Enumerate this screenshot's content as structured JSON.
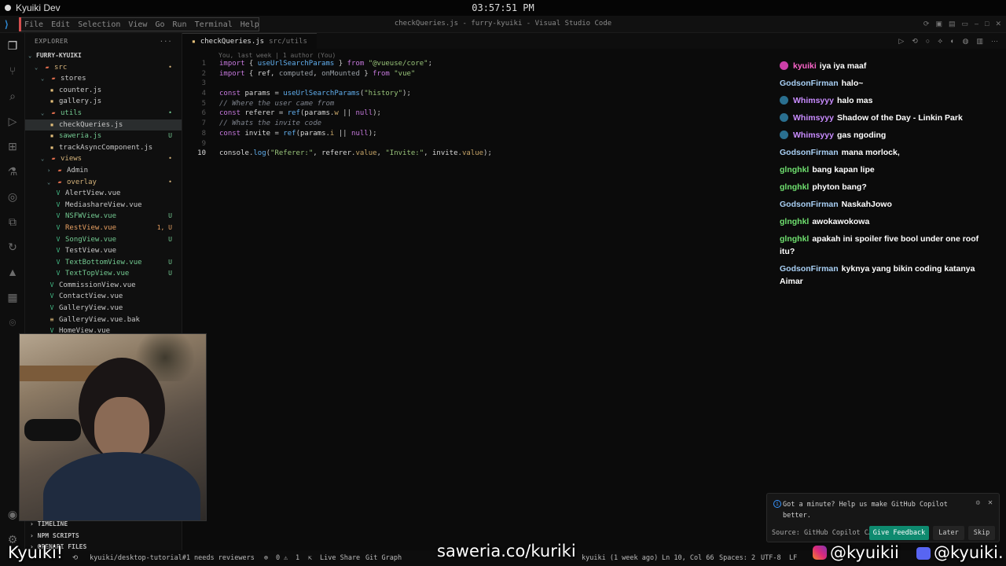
{
  "system_bar": {
    "app_name": "Kyuiki Dev",
    "clock": "03:57:51 PM"
  },
  "titlebar": {
    "menu": [
      "File",
      "Edit",
      "Selection",
      "View",
      "Go",
      "Run",
      "Terminal",
      "Help"
    ],
    "window_title": "checkQueries.js - furry-kyuiki - Visual Studio Code"
  },
  "sidebar": {
    "header": "EXPLORER",
    "project": "FURRY-KYUIKI",
    "tree": [
      {
        "label": "src",
        "kind": "folder",
        "indent": 1,
        "open": true,
        "badge": "•",
        "badge_class": "mod"
      },
      {
        "label": "stores",
        "kind": "folder",
        "indent": 2,
        "open": true,
        "badge": "",
        "badge_class": ""
      },
      {
        "label": "counter.js",
        "kind": "js",
        "indent": 3,
        "badge": "",
        "badge_class": ""
      },
      {
        "label": "gallery.js",
        "kind": "js",
        "indent": 3,
        "badge": "",
        "badge_class": ""
      },
      {
        "label": "utils",
        "kind": "folder",
        "indent": 2,
        "open": true,
        "badge": "•",
        "badge_class": "untracked"
      },
      {
        "label": "checkQueries.js",
        "kind": "js",
        "indent": 3,
        "badge": "",
        "badge_class": "",
        "selected": true
      },
      {
        "label": "saweria.js",
        "kind": "js",
        "indent": 3,
        "badge": "U",
        "badge_class": "untracked"
      },
      {
        "label": "trackAsyncComponent.js",
        "kind": "js",
        "indent": 3,
        "badge": "",
        "badge_class": ""
      },
      {
        "label": "views",
        "kind": "folder",
        "indent": 2,
        "open": true,
        "badge": "•",
        "badge_class": "mod"
      },
      {
        "label": "Admin",
        "kind": "folder",
        "indent": 3,
        "open": false,
        "badge": "",
        "badge_class": ""
      },
      {
        "label": "overlay",
        "kind": "folder",
        "indent": 3,
        "open": true,
        "badge": "•",
        "badge_class": "mod"
      },
      {
        "label": "AlertView.vue",
        "kind": "vue",
        "indent": 4,
        "badge": "",
        "badge_class": ""
      },
      {
        "label": "MediashareView.vue",
        "kind": "vue",
        "indent": 4,
        "badge": "",
        "badge_class": ""
      },
      {
        "label": "NSFWView.vue",
        "kind": "vue",
        "indent": 4,
        "badge": "U",
        "badge_class": "untracked"
      },
      {
        "label": "RestView.vue",
        "kind": "vue",
        "indent": 4,
        "badge": "1, U",
        "badge_class": "err"
      },
      {
        "label": "SongView.vue",
        "kind": "vue",
        "indent": 4,
        "badge": "U",
        "badge_class": "untracked"
      },
      {
        "label": "TestView.vue",
        "kind": "vue",
        "indent": 4,
        "badge": "",
        "badge_class": ""
      },
      {
        "label": "TextBottomView.vue",
        "kind": "vue",
        "indent": 4,
        "badge": "U",
        "badge_class": "untracked"
      },
      {
        "label": "TextTopView.vue",
        "kind": "vue",
        "indent": 4,
        "badge": "U",
        "badge_class": "untracked"
      },
      {
        "label": "CommissionView.vue",
        "kind": "vue",
        "indent": 3,
        "badge": "",
        "badge_class": ""
      },
      {
        "label": "ContactView.vue",
        "kind": "vue",
        "indent": 3,
        "badge": "",
        "badge_class": ""
      },
      {
        "label": "GalleryView.vue",
        "kind": "vue",
        "indent": 3,
        "badge": "",
        "badge_class": ""
      },
      {
        "label": "GalleryView.vue.bak",
        "kind": "bak",
        "indent": 3,
        "badge": "",
        "badge_class": ""
      },
      {
        "label": "HomeView.vue",
        "kind": "vue",
        "indent": 3,
        "badge": "",
        "badge_class": ""
      }
    ],
    "sections": {
      "timeline": "TIMELINE",
      "npm_scripts": "NPM SCRIPTS",
      "openapi": "OPENAPI FILES"
    }
  },
  "editor": {
    "tab_name": "checkQueries.js",
    "tab_path": "src/utils",
    "blame": "You, last week | 1 author (You)",
    "lines": [
      {
        "n": "1",
        "html": "<span class='kw'>import</span> { <span class='fn'>useUrlSearchParams</span> } <span class='kw'>from</span> <span class='str'>\"@vueuse/core\"</span>;"
      },
      {
        "n": "2",
        "html": "<span class='kw'>import</span> { <span class='id'>ref</span>, <span class='gray'>computed</span>, <span class='gray'>onMounted</span> } <span class='kw'>from</span> <span class='str'>\"vue\"</span>"
      },
      {
        "n": "3",
        "html": ""
      },
      {
        "n": "4",
        "html": "<span class='kw'>const</span> <span class='id'>params</span> = <span class='fn'>useUrlSearchParams</span>(<span class='str'>\"history\"</span>);"
      },
      {
        "n": "5",
        "html": "<span class='cm'>// Where the user came from</span>"
      },
      {
        "n": "6",
        "html": "<span class='kw'>const</span> <span class='id'>referer</span> = <span class='fn'>ref</span>(<span class='id'>params</span>.<span class='pr'>w</span> || <span class='kw'>null</span>);"
      },
      {
        "n": "7",
        "html": "<span class='cm'>// Whats the invite code</span>"
      },
      {
        "n": "8",
        "html": "<span class='kw'>const</span> <span class='id'>invite</span> = <span class='fn'>ref</span>(<span class='id'>params</span>.<span class='pr'>i</span> || <span class='kw'>null</span>);"
      },
      {
        "n": "9",
        "html": ""
      },
      {
        "n": "10",
        "html": "<span class='id'>console</span>.<span class='fn'>log</span>(<span class='str'>\"Referer:\"</span>, <span class='id'>referer</span>.<span class='pr'>value</span>, <span class='str'>\"Invite:\"</span>, <span class='id'>invite</span>.<span class='pr'>value</span>);"
      }
    ]
  },
  "chat": [
    {
      "user": "kyuiki",
      "color": "u-kyuiki",
      "icon": "mic",
      "text": "iya iya maaf"
    },
    {
      "user": "GodsonFirman",
      "color": "u-godson",
      "icon": "",
      "text": "halo~"
    },
    {
      "user": "Whimsyyy",
      "color": "u-whims",
      "icon": "badge",
      "text": "halo mas"
    },
    {
      "user": "Whimsyyy",
      "color": "u-whims",
      "icon": "badge",
      "text": "Shadow of the Day - Linkin Park"
    },
    {
      "user": "Whimsyyy",
      "color": "u-whims",
      "icon": "badge",
      "text": "gas ngoding"
    },
    {
      "user": "GodsonFirman",
      "color": "u-godson",
      "icon": "",
      "text": "mana morlock,"
    },
    {
      "user": "glnghkl",
      "color": "u-glng",
      "icon": "",
      "text": "bang kapan lipe"
    },
    {
      "user": "glnghkl",
      "color": "u-glng",
      "icon": "",
      "text": "phyton bang?"
    },
    {
      "user": "GodsonFirman",
      "color": "u-godson",
      "icon": "",
      "text": "NaskahJowo"
    },
    {
      "user": "glnghkl",
      "color": "u-glng",
      "icon": "",
      "text": "awokawokowa"
    },
    {
      "user": "glnghkl",
      "color": "u-glng",
      "icon": "",
      "text": "apakah ini spoiler five bool under one roof itu?"
    },
    {
      "user": "GodsonFirman",
      "color": "u-godson",
      "icon": "",
      "text": "kyknya yang bikin coding katanya Aimar"
    }
  ],
  "notification": {
    "message": "Got a minute? Help us make GitHub Copilot better.",
    "source": "Source: GitHub Copilot C…",
    "primary": "Give Feedback",
    "later": "Later",
    "skip": "Skip"
  },
  "statusbar": {
    "branch_status": "kyuiki/desktop-tutorial#1 needs reviewers",
    "errors": "0",
    "warnings": "1",
    "live_share": "Live Share",
    "git_graph": "Git Graph",
    "blame": "kyuiki (1 week ago)",
    "position": "Ln 10, Col 66",
    "spaces": "Spaces: 2",
    "encoding": "UTF-8",
    "eol": "LF"
  },
  "overlay": {
    "name": "Kyuiki!",
    "saweria": "saweria.co/kuriki",
    "instagram": "@kyuikii",
    "discord": "@kyuiki."
  }
}
